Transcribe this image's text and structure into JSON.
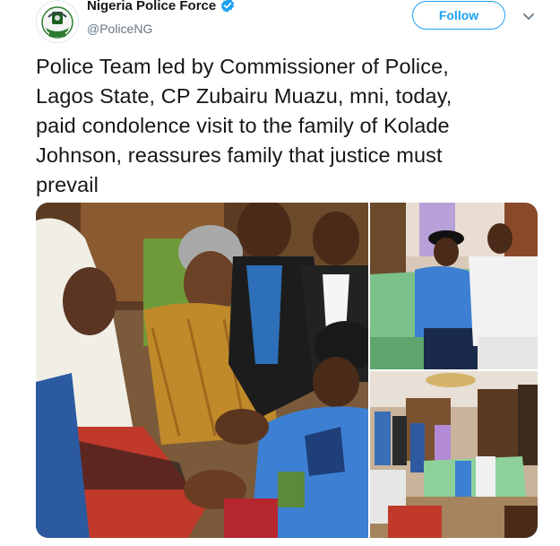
{
  "account": {
    "display_name": "Nigeria Police Force",
    "handle": "@PoliceNG",
    "verified_icon": "verified-badge-icon",
    "avatar_icon": "police-crest-logo"
  },
  "actions": {
    "follow_label": "Follow",
    "menu_icon": "chevron-down-icon"
  },
  "tweet": {
    "text_lines": [
      "Police Team led by Commissioner of Police,",
      "Lagos State, CP Zubairu Muazu, mni, today,",
      "paid condolence visit to the family of Kolade",
      "Johnson, reassures family that justice must",
      "prevail"
    ]
  },
  "media": {
    "photo_count": 3
  },
  "colors": {
    "accent": "#1da1f2",
    "text": "#14171a",
    "secondary_text": "#657786"
  }
}
